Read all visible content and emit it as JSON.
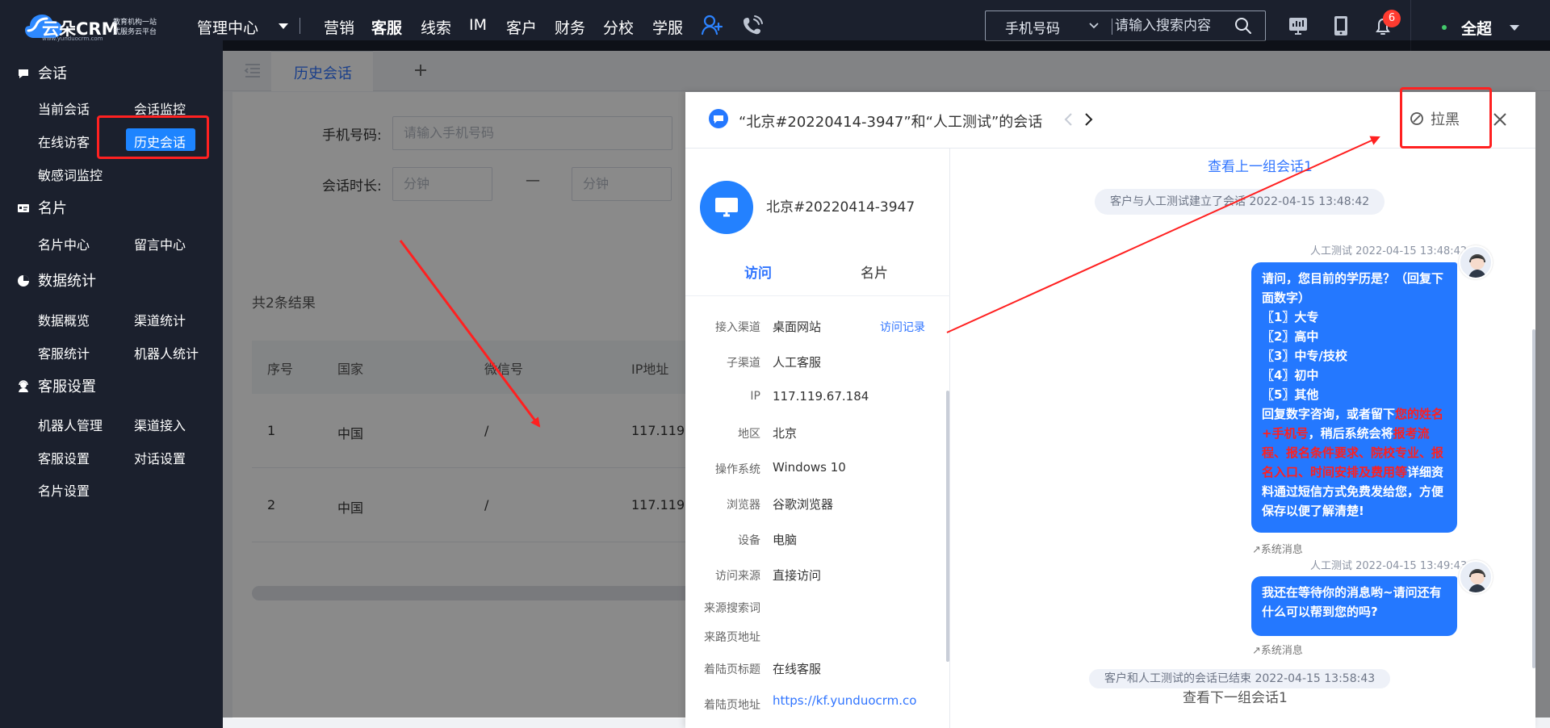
{
  "app": {
    "brand": {
      "name": "云朵CRM",
      "slogan_lines": [
        "教育机构一站",
        "式服务云平台"
      ],
      "url": "www.yunduocrm.com",
      "accent_color": "#1d84ff"
    },
    "topbar": {
      "management": "管理中心",
      "nav": [
        "营销",
        "客服",
        "线索",
        "IM",
        "客户",
        "财务",
        "分校",
        "学服"
      ],
      "active_nav": "客服",
      "search": {
        "type": "手机号码",
        "placeholder": "请输入搜索内容"
      },
      "notification_count": "6",
      "user": "全超",
      "icons": [
        "add-user-icon",
        "phone-icon",
        "monitor-icon",
        "tablet-icon",
        "bell-icon"
      ]
    },
    "sidebar": {
      "sections": [
        {
          "title": "会话",
          "icon": "chat-icon",
          "items": [
            "当前会话",
            "会话监控",
            "在线访客",
            "历史会话",
            "敏感词监控"
          ]
        },
        {
          "title": "名片",
          "icon": "card-icon",
          "items": [
            "名片中心",
            "留言中心"
          ]
        },
        {
          "title": "数据统计",
          "icon": "pie-icon",
          "items": [
            "数据概览",
            "渠道统计",
            "客服统计",
            "机器人统计"
          ]
        },
        {
          "title": "客服设置",
          "icon": "service-icon",
          "items": [
            "机器人管理",
            "渠道接入",
            "客服设置",
            "对话设置",
            "名片设置"
          ]
        }
      ],
      "active_item": "历史会话"
    },
    "main": {
      "tab": "历史会话",
      "filters": {
        "phone_label": "手机号码:",
        "phone_placeholder": "请输入手机号码",
        "duration_label": "会话时长:",
        "duration_from": "分钟",
        "duration_sep": "—",
        "duration_to": "分钟"
      },
      "result_count": "共2条结果",
      "table": {
        "columns": [
          "序号",
          "国家",
          "微信号",
          "IP地址"
        ],
        "rows": [
          [
            "1",
            "中国",
            "/",
            "117.119."
          ],
          [
            "2",
            "中国",
            "/",
            "117.119."
          ]
        ]
      }
    },
    "drawer": {
      "title": "“北京#20220414-3947”和“人工测试”的会话",
      "blacklist": "拉黑",
      "visitor": {
        "name": "北京#20220414-3947",
        "tabs": [
          "访问",
          "名片"
        ],
        "active_tab": "访问"
      },
      "info": [
        {
          "label": "接入渠道",
          "value": "桌面网站",
          "action": "访问记录"
        },
        {
          "label": "子渠道",
          "value": "人工客服"
        },
        {
          "label": "IP",
          "value": "117.119.67.184"
        },
        {
          "label": "地区",
          "value": "北京"
        },
        {
          "label": "操作系统",
          "value": "Windows 10"
        },
        {
          "label": "浏览器",
          "value": "谷歌浏览器"
        },
        {
          "label": "设备",
          "value": "电脑"
        },
        {
          "label": "访问来源",
          "value": "直接访问"
        },
        {
          "label": "来源搜索词",
          "value": ""
        },
        {
          "label": "来路页地址",
          "value": ""
        },
        {
          "label": "着陆页标题",
          "value": "在线客服"
        },
        {
          "label": "着陆页地址",
          "value": "https://kf.yunduocrm.co"
        }
      ],
      "chat": {
        "prev_link": "查看上一组会话1",
        "system_start": "客户与人工测试建立了会话 2022-04-15 13:48:42",
        "message_1_meta": "人工测试 2022-04-15 13:48:42",
        "message_1_text": {
          "line_1": "请问，您目前的学历是？（回复下",
          "line_2": "面数字）",
          "line_3": "〖1〗大专",
          "line_4": "〖2〗高中",
          "line_5": "〖3〗中专/技校",
          "line_6": "〖4〗初中",
          "line_7": "〖5〗其他",
          "line_8a": "回复数字咨询，或者留下",
          "line_8b": "您的姓名",
          "line_9a": "+手机号",
          "line_9b": "，稍后系统会将",
          "line_9c": "报考流",
          "line_10a": "程、报名条件要求、院校专业、报",
          "line_11a": "名入口、时间安排及费用等",
          "line_11b": "详细资",
          "line_12": "料通过短信方式免费发给您，方便",
          "line_13": "保存以便了解清楚!"
        },
        "system_tag_1": "↗系统消息",
        "message_2_meta": "人工测试 2022-04-15 13:49:43",
        "message_2_text": {
          "line_1": "我还在等待你的消息哟~请问还有",
          "line_2": "什么可以帮到您的吗?"
        },
        "system_tag_2": "↗系统消息",
        "system_end": "客户和人工测试的会话已结束 2022-04-15 13:58:43",
        "next_link": "查看下一组会话1"
      }
    },
    "colors": {
      "topbar": "#1b202d",
      "primary": "#2478ff",
      "highlight": "#ff1f1f"
    }
  }
}
